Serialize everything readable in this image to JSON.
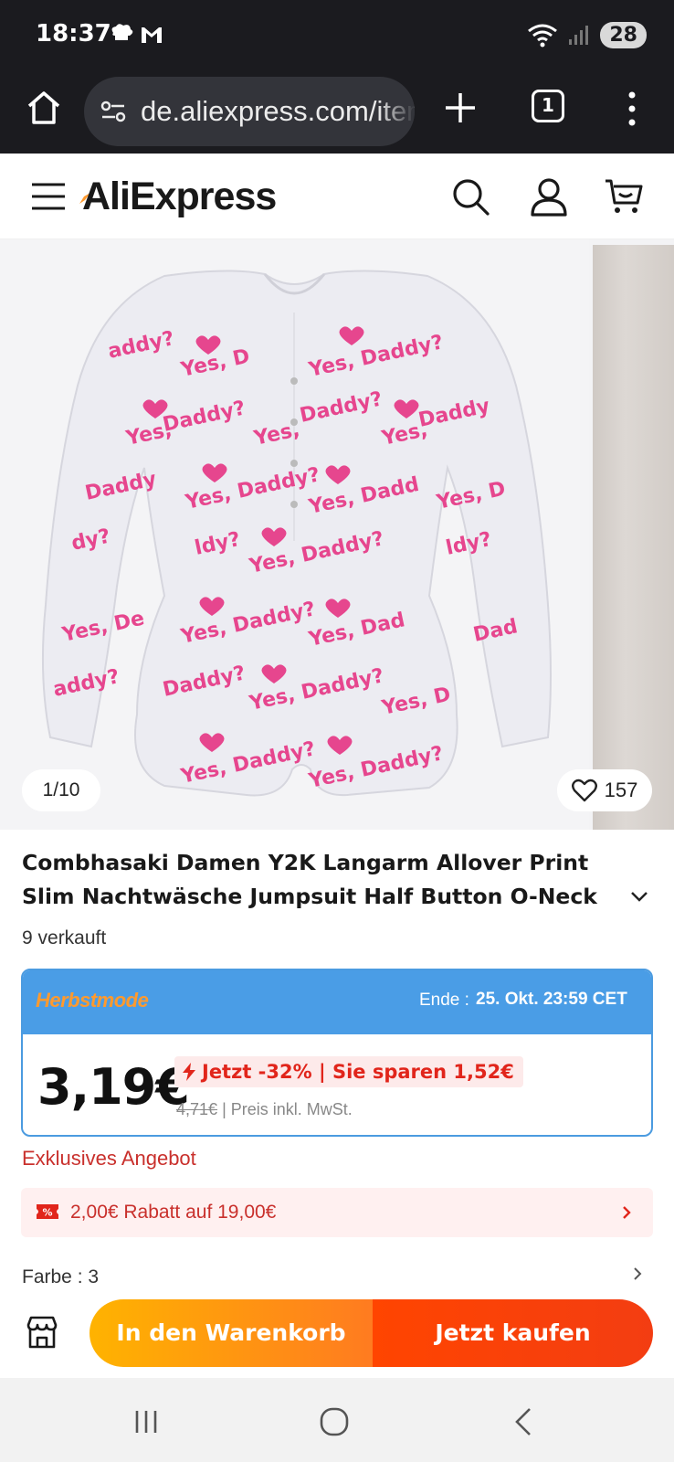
{
  "status_bar": {
    "time": "18:37",
    "battery": "28",
    "notification_icons": [
      "chef-hat-icon",
      "gmail-icon"
    ],
    "status_icons": [
      "wifi-icon",
      "signal-icon"
    ]
  },
  "browser": {
    "url": "de.aliexpress.com/item",
    "tab_count": "1"
  },
  "header": {
    "logo": "AliExpress",
    "icons": [
      "search-icon",
      "user-icon",
      "cart-icon"
    ]
  },
  "gallery": {
    "counter": "1/10",
    "wishlist_count": "157"
  },
  "product": {
    "title": "Combhasaki Damen Y2K Langarm Allover Print Slim Nachtwäsche Jumpsuit Half Button O-Neck",
    "sold": "9 verkauft"
  },
  "promo": {
    "label": "Herbstmode",
    "end_label": "Ende :",
    "end_value": "25. Okt. 23:59 CET",
    "price": "3,19€",
    "discount": "Jetzt -32% | Sie sparen 1,52€",
    "original_price": "4,71€",
    "tax_note": "| Preis inkl. MwSt."
  },
  "exclusive": "Exklusives Angebot",
  "coupon": {
    "text": "2,00€ Rabatt auf 19,00€"
  },
  "variant": {
    "label": "Farbe : 3"
  },
  "actions": {
    "add_to_cart": "In den Warenkorb",
    "buy_now": "Jetzt kaufen"
  },
  "colors": {
    "accent_red": "#e1251b",
    "promo_blue": "#4a9de6",
    "cart_orange": "#ffb300",
    "buy_red": "#ff4500"
  }
}
